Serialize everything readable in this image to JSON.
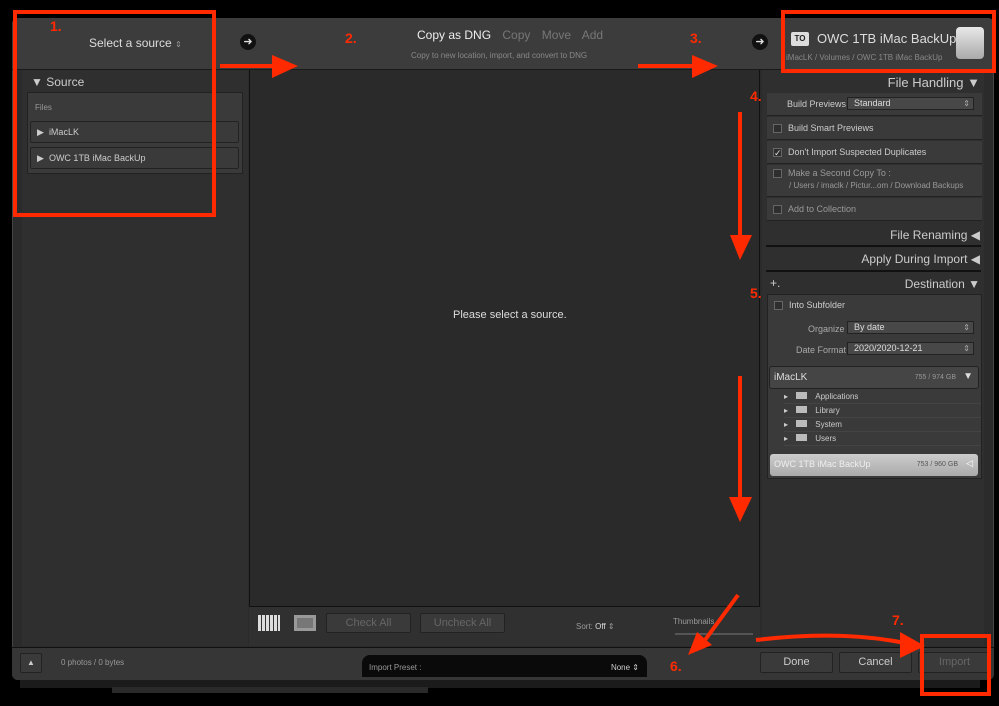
{
  "header": {
    "source_label": "Select a source",
    "modes": [
      "Copy as DNG",
      "Copy",
      "Move",
      "Add"
    ],
    "active_mode": "Copy as DNG",
    "mode_description": "Copy to new location, import, and convert to DNG",
    "to_badge": "TO",
    "destination_name": "OWC 1TB iMac BackUp",
    "destination_path": "iMacLK / Volumes / OWC 1TB iMac BackUp"
  },
  "source_panel": {
    "title": "Source",
    "files_label": "Files",
    "items": [
      "iMacLK",
      "OWC 1TB iMac BackUp"
    ]
  },
  "main": {
    "empty_message": "Please select a source.",
    "check_all": "Check All",
    "uncheck_all": "Uncheck All",
    "sort_label": "Sort:",
    "sort_value": "Off",
    "thumbnails_label": "Thumbnails"
  },
  "file_handling": {
    "title": "File Handling",
    "build_previews_label": "Build Previews",
    "build_previews_value": "Standard",
    "build_smart_previews": "Build Smart Previews",
    "dont_import_duplicates": "Don't Import Suspected Duplicates",
    "second_copy": "Make a Second Copy To :",
    "second_copy_path": "/ Users / imaclk / Pictur...om / Download Backups",
    "add_to_collection": "Add to Collection"
  },
  "file_renaming": {
    "title": "File Renaming"
  },
  "apply_during_import": {
    "title": "Apply During Import"
  },
  "destination": {
    "title": "Destination",
    "into_subfolder": "Into Subfolder",
    "organize_label": "Organize",
    "organize_value": "By date",
    "date_format_label": "Date Format",
    "date_format_value": "2020/2020-12-21",
    "volumes": [
      {
        "name": "iMacLK",
        "space": "755 / 974 GB"
      },
      {
        "name": "OWC 1TB iMac BackUp",
        "space": "753 / 960 GB"
      }
    ],
    "folders": [
      "Applications",
      "Library",
      "System",
      "Users"
    ]
  },
  "footer": {
    "count": "0 photos / 0 bytes",
    "preset_label": "Import Preset :",
    "preset_value": "None",
    "done": "Done",
    "cancel": "Cancel",
    "import": "Import"
  },
  "annotations": {
    "steps": [
      "1.",
      "2.",
      "3.",
      "4.",
      "5.",
      "6.",
      "7."
    ],
    "color": "#ff2a00"
  }
}
